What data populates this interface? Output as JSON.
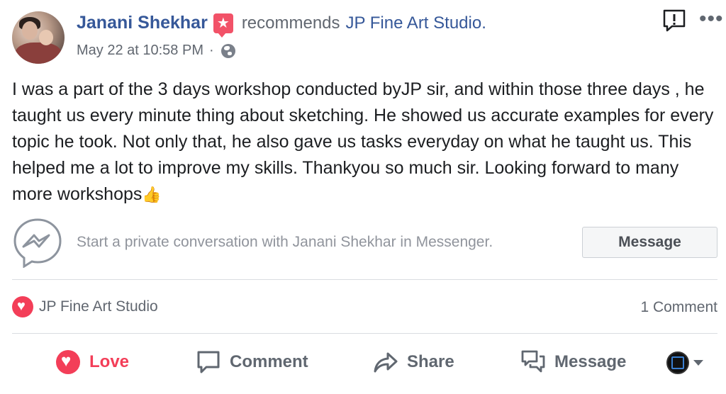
{
  "post": {
    "author": "Janani Shekhar",
    "action_text": "recommends",
    "page_name": "JP Fine Art Studio.",
    "timestamp": "May 22 at 10:58 PM",
    "separator": "·",
    "privacy_icon": "globe-icon",
    "body": "I was a part of the 3 days workshop conducted byJP sir, and within those three days , he taught us every minute thing about sketching. He showed us accurate examples for every topic he took. Not only that, he also gave us tasks everyday on what he taught us. This helped me a lot to improve my skills. Thankyou so much sir. Looking forward to many more workshops",
    "body_emoji": "👍"
  },
  "messenger": {
    "prompt": "Start a private conversation with Janani Shekhar in Messenger.",
    "button_label": "Message"
  },
  "reactions": {
    "reactor": "JP Fine Art Studio",
    "comment_count": "1 Comment"
  },
  "actions": {
    "love": "Love",
    "comment": "Comment",
    "share": "Share",
    "message": "Message"
  },
  "colors": {
    "link_blue": "#365899",
    "love_red": "#f33e58",
    "recommend_red": "#f25268",
    "muted_gray": "#616770"
  }
}
